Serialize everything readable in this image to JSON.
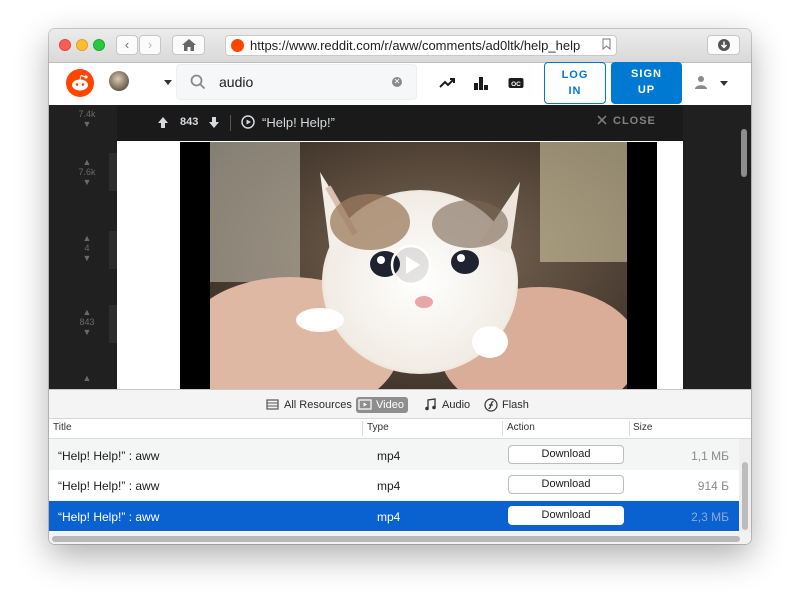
{
  "browser": {
    "url": "https://www.reddit.com/r/aww/comments/ad0ltk/help_help"
  },
  "reddit": {
    "search_query": "audio",
    "login_label_1": "LOG",
    "login_label_2": "IN",
    "signup_label_1": "SIGN",
    "signup_label_2": "UP"
  },
  "feed": {
    "scores": [
      "7.4k",
      "7.6k",
      "4",
      "843"
    ]
  },
  "modal": {
    "score": "843",
    "title": "“Help! Help!”",
    "close_label": "CLOSE"
  },
  "resources": {
    "filters": [
      {
        "label": "All Resources",
        "icon": "resources-icon",
        "active": false
      },
      {
        "label": "Video",
        "icon": "video-icon",
        "active": true
      },
      {
        "label": "Audio",
        "icon": "music-note-icon",
        "active": false
      },
      {
        "label": "Flash",
        "icon": "flash-icon",
        "active": false
      }
    ],
    "columns": [
      "Title",
      "Type",
      "Action",
      "Size"
    ],
    "download_label": "Download",
    "rows": [
      {
        "title": "“Help! Help!” : aww",
        "type": "mp4",
        "size": "1,1 МБ",
        "selected": false
      },
      {
        "title": "“Help! Help!” : aww",
        "type": "mp4",
        "size": "914 Б",
        "selected": false
      },
      {
        "title": "“Help! Help!” : aww",
        "type": "mp4",
        "size": "2,3 МБ",
        "selected": true
      }
    ]
  },
  "colors": {
    "reddit_orange": "#ff4500",
    "reddit_blue": "#0079d3",
    "selection_blue": "#0a62d0"
  }
}
